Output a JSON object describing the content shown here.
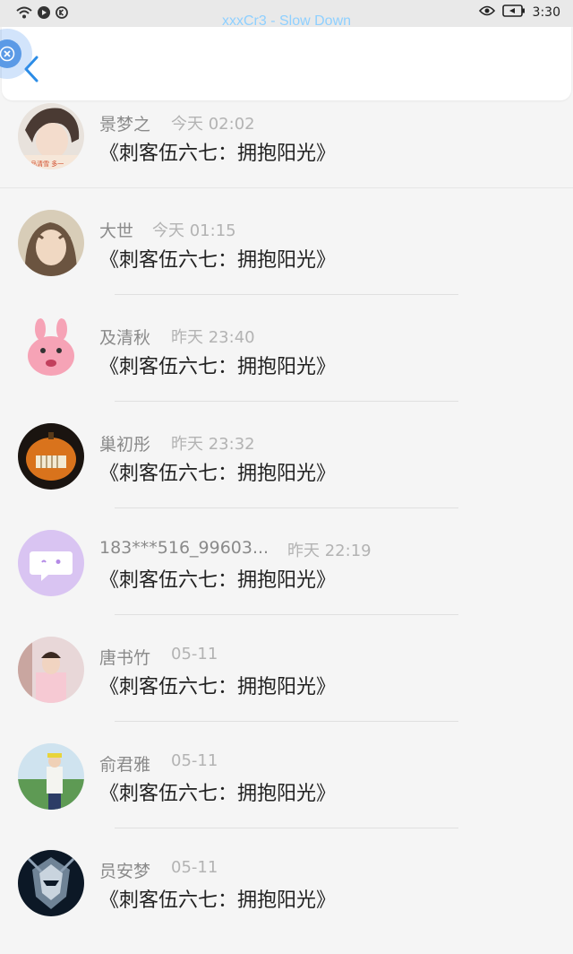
{
  "status": {
    "time": "3:30"
  },
  "media": {
    "now_playing": "xxxCr3 - Slow Down"
  },
  "header": {},
  "list": [
    {
      "name": "景梦之",
      "time": "今天 02:02",
      "title": "《刺客伍六七：拥抱阳光》"
    },
    {
      "name": "大世",
      "time": "今天 01:15",
      "title": "《刺客伍六七：拥抱阳光》"
    },
    {
      "name": "及清秋",
      "time": "昨天 23:40",
      "title": "《刺客伍六七：拥抱阳光》"
    },
    {
      "name": "巢初彤",
      "time": "昨天 23:32",
      "title": "《刺客伍六七：拥抱阳光》"
    },
    {
      "name": "183***516_99603...",
      "time": "昨天 22:19",
      "title": "《刺客伍六七：拥抱阳光》"
    },
    {
      "name": "唐书竹",
      "time": "05-11",
      "title": "《刺客伍六七：拥抱阳光》"
    },
    {
      "name": "俞君雅",
      "time": "05-11",
      "title": "《刺客伍六七：拥抱阳光》"
    },
    {
      "name": "员安梦",
      "time": "05-11",
      "title": "《刺客伍六七：拥抱阳光》"
    }
  ],
  "colors": {
    "accent": "#2b8ce6",
    "divider": "#e0e0e0",
    "name_text": "#8a8a8a",
    "time_text": "#b3b3b3",
    "title_text": "#222222"
  }
}
